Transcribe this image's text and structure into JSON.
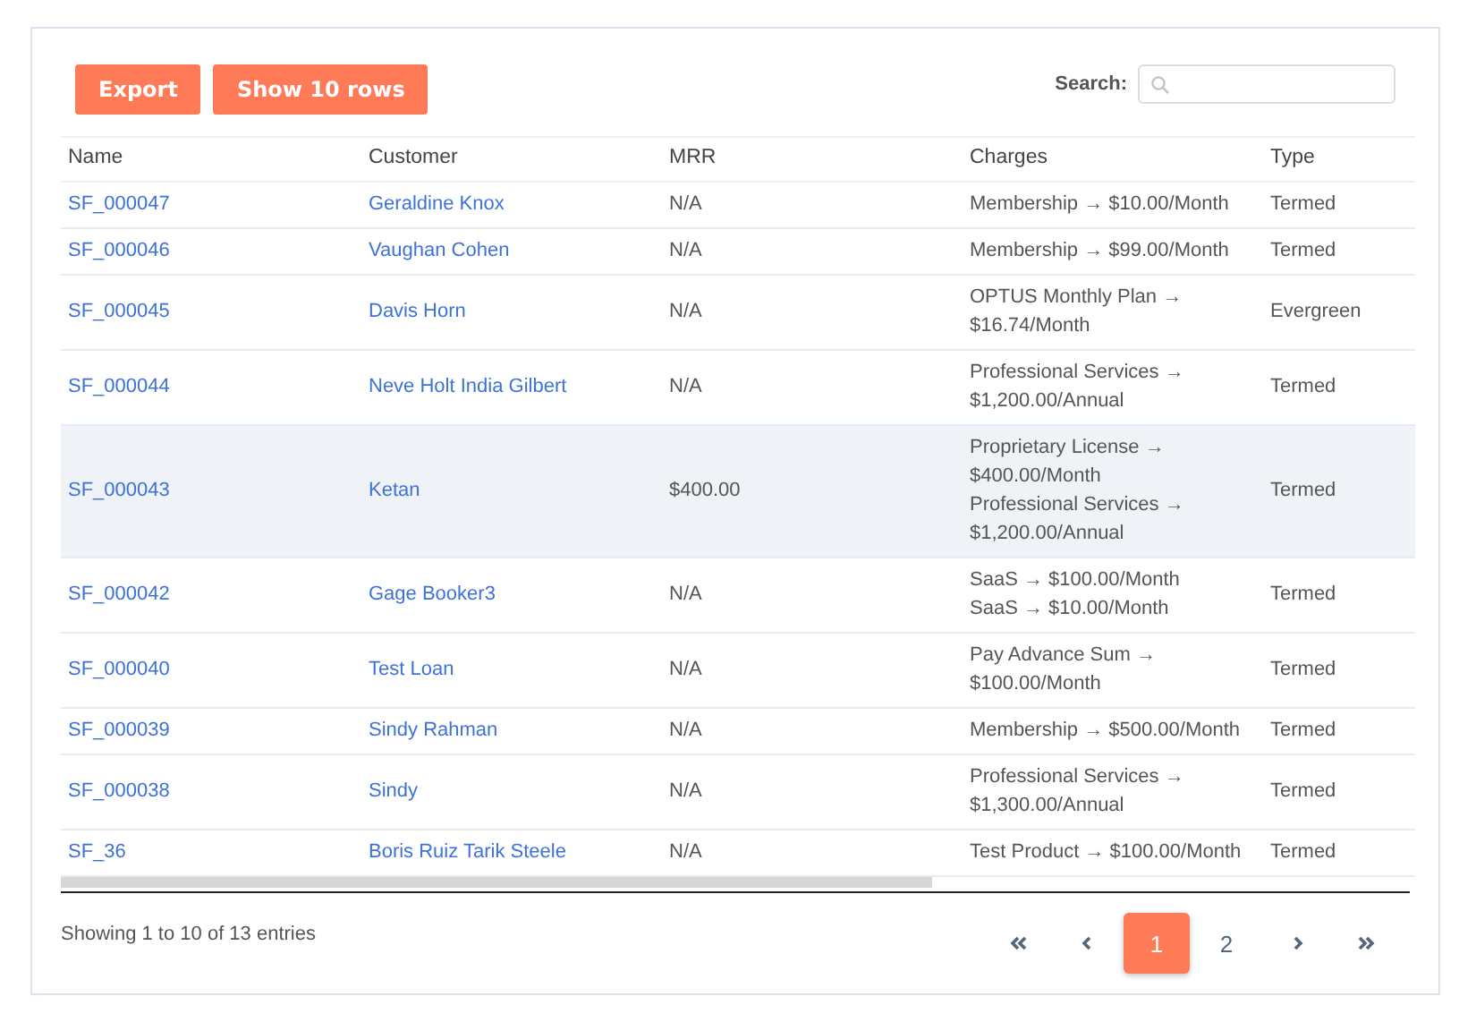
{
  "toolbar": {
    "buttons": [
      "Export",
      "Show 10 rows"
    ],
    "search": {
      "label": "Search:"
    }
  },
  "table": {
    "columns": [
      "Name",
      "Customer",
      "MRR",
      "Charges",
      "Type"
    ],
    "rows": [
      {
        "name": "SF_000047",
        "customer": "Geraldine Knox",
        "mrr": "N/A",
        "charges": [
          "Membership → $10.00/Month"
        ],
        "type": "Termed",
        "highlighted": false
      },
      {
        "name": "SF_000046",
        "customer": "Vaughan Cohen",
        "mrr": "N/A",
        "charges": [
          "Membership → $99.00/Month"
        ],
        "type": "Termed",
        "highlighted": false
      },
      {
        "name": "SF_000045",
        "customer": "Davis Horn",
        "mrr": "N/A",
        "charges": [
          "OPTUS Monthly Plan → $16.74/Month"
        ],
        "type": "Evergreen",
        "highlighted": false
      },
      {
        "name": "SF_000044",
        "customer": "Neve Holt India Gilbert",
        "mrr": "N/A",
        "charges": [
          "Professional Services → $1,200.00/Annual"
        ],
        "type": "Termed",
        "highlighted": false
      },
      {
        "name": "SF_000043",
        "customer": "Ketan",
        "mrr": "$400.00",
        "charges": [
          "Proprietary License → $400.00/Month",
          "Professional Services → $1,200.00/Annual"
        ],
        "type": "Termed",
        "highlighted": true
      },
      {
        "name": "SF_000042",
        "customer": "Gage Booker3",
        "mrr": "N/A",
        "charges": [
          "SaaS → $100.00/Month",
          "SaaS → $10.00/Month"
        ],
        "type": "Termed",
        "highlighted": false
      },
      {
        "name": "SF_000040",
        "customer": "Test Loan",
        "mrr": "N/A",
        "charges": [
          "Pay Advance Sum → $100.00/Month"
        ],
        "type": "Termed",
        "highlighted": false
      },
      {
        "name": "SF_000039",
        "customer": "Sindy Rahman",
        "mrr": "N/A",
        "charges": [
          "Membership → $500.00/Month"
        ],
        "type": "Termed",
        "highlighted": false
      },
      {
        "name": "SF_000038",
        "customer": "Sindy",
        "mrr": "N/A",
        "charges": [
          "Professional Services → $1,300.00/Annual"
        ],
        "type": "Termed",
        "highlighted": false
      },
      {
        "name": "SF_36",
        "customer": "Boris Ruiz Tarik Steele",
        "mrr": "N/A",
        "charges": [
          "Test Product → $100.00/Month"
        ],
        "type": "Termed",
        "highlighted": false
      }
    ]
  },
  "footer": {
    "info": "Showing 1 to 10 of 13 entries",
    "pages": [
      {
        "kind": "first"
      },
      {
        "kind": "prev"
      },
      {
        "kind": "page",
        "label": "1",
        "selected": true
      },
      {
        "kind": "page",
        "label": "2",
        "selected": false
      },
      {
        "kind": "next"
      },
      {
        "kind": "last"
      }
    ]
  }
}
